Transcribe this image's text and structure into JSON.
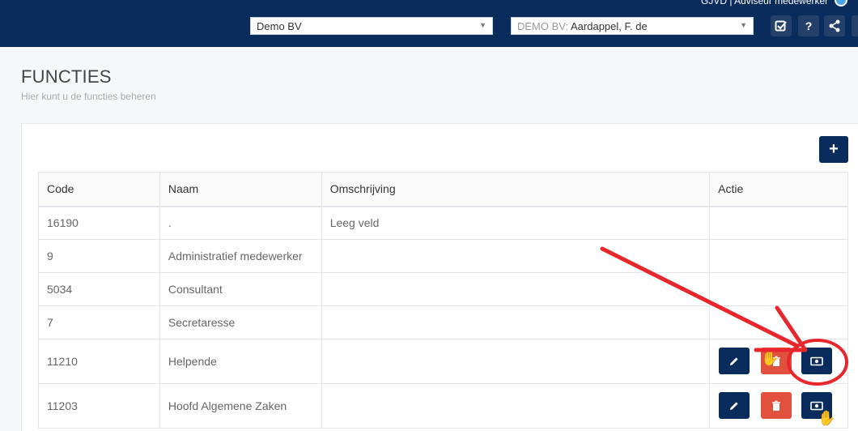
{
  "header": {
    "user_text": "GJVD | Adviseur medewerker",
    "company_select": {
      "value": "Demo BV"
    },
    "employee_select": {
      "prefix": "DEMO BV:",
      "value": "Aardappel, F. de"
    },
    "icons": [
      "checklist-icon",
      "help-icon",
      "share-icon"
    ]
  },
  "page": {
    "title": "FUNCTIES",
    "subtitle": "Hier kunt u de functies beheren"
  },
  "add_button": {
    "label": "+"
  },
  "table": {
    "headers": [
      "Code",
      "Naam",
      "Omschrijving",
      "Actie"
    ],
    "rows": [
      {
        "code": "16190",
        "naam": ".",
        "omschrijving": "Leeg veld"
      },
      {
        "code": "9",
        "naam": "Administratief medewerker",
        "omschrijving": ""
      },
      {
        "code": "5034",
        "naam": "Consultant",
        "omschrijving": ""
      },
      {
        "code": "7",
        "naam": "Secretaresse",
        "omschrijving": ""
      },
      {
        "code": "11210",
        "naam": "Helpende",
        "omschrijving": ""
      },
      {
        "code": "11203",
        "naam": "Hoofd Algemene Zaken",
        "omschrijving": ""
      }
    ]
  },
  "colors": {
    "navy": "#0a2c5c",
    "danger": "#e2503e",
    "annotation": "#e8262b"
  }
}
